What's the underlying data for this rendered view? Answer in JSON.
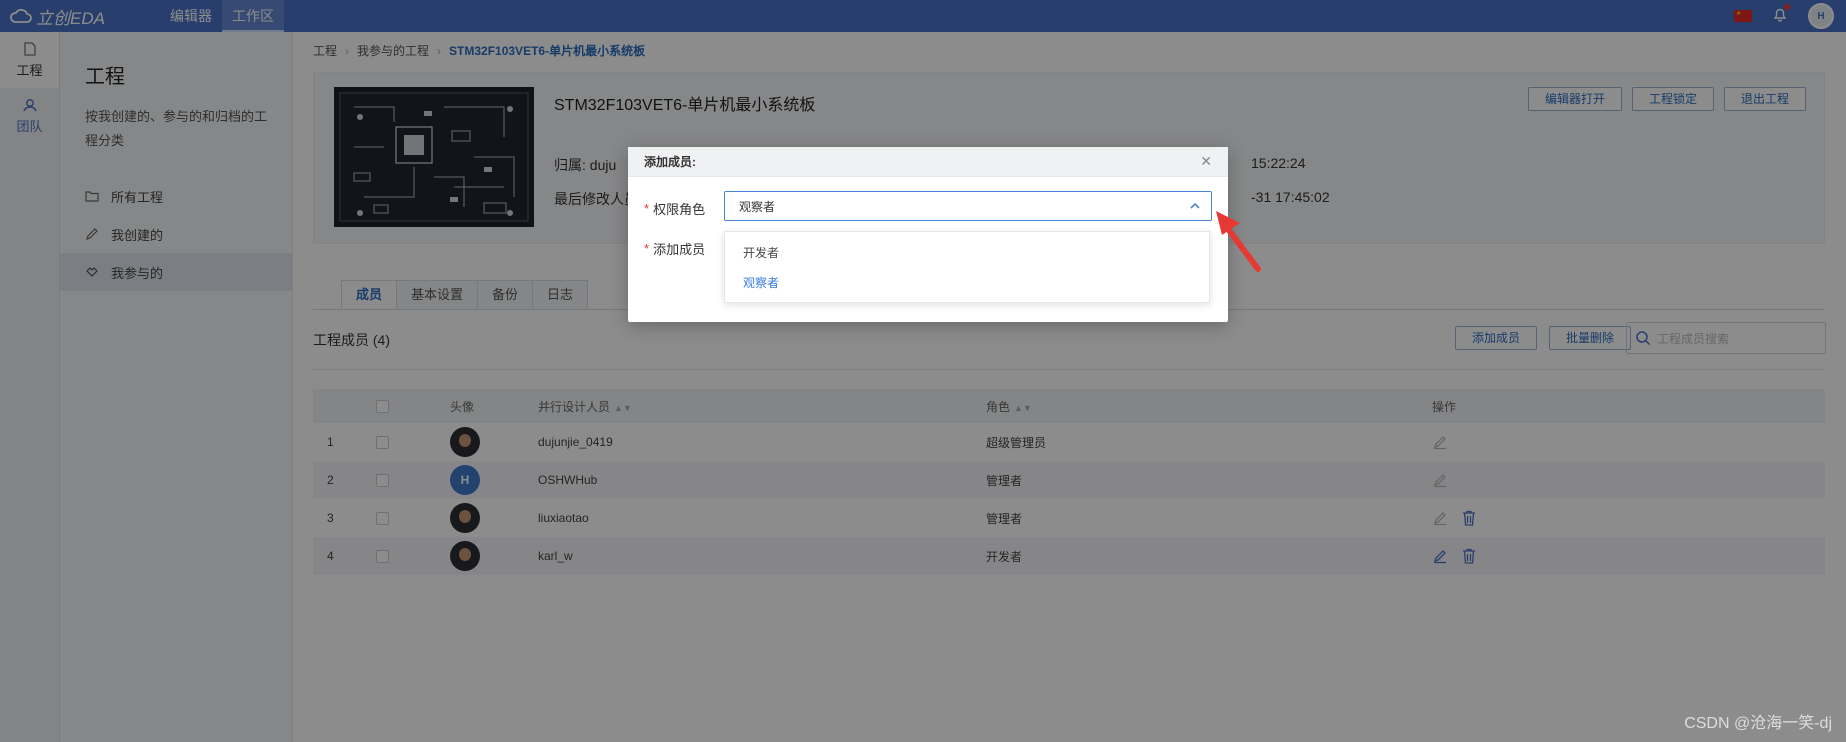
{
  "app": {
    "logo_text": "立创EDA",
    "nav": [
      "编辑器",
      "工作区"
    ]
  },
  "rail": {
    "items": [
      {
        "label": "工程"
      },
      {
        "label": "团队"
      }
    ]
  },
  "sidebar": {
    "title": "工程",
    "desc": "按我创建的、参与的和归档的工程分类",
    "menu": [
      {
        "label": "所有工程"
      },
      {
        "label": "我创建的"
      },
      {
        "label": "我参与的"
      }
    ]
  },
  "breadcrumb": [
    "工程",
    "我参与的工程",
    "STM32F103VET6-单片机最小系统板"
  ],
  "project": {
    "title": "STM32F103VET6-单片机最小系统板",
    "owner_label": "归属:",
    "owner_partial": "duju",
    "last_modifier_label": "最后修改人员",
    "date1_partial": "15:22:24",
    "date2_partial": "-31 17:45:02",
    "buttons": [
      "编辑器打开",
      "工程锁定",
      "退出工程"
    ]
  },
  "tabs": [
    "成员",
    "基本设置",
    "备份",
    "日志"
  ],
  "members": {
    "title": "工程成员 (4)",
    "add_button": "添加成员",
    "batch_delete_button": "批量删除",
    "search_placeholder": "工程成员搜索",
    "columns": {
      "avatar": "头像",
      "designer": "并行设计人员",
      "role": "角色",
      "ops": "操作"
    },
    "rows": [
      {
        "idx": "1",
        "name": "dujunjie_0419",
        "role": "超级管理员"
      },
      {
        "idx": "2",
        "name": "OSHWHub",
        "role": "管理者"
      },
      {
        "idx": "3",
        "name": "liuxiaotao",
        "role": "管理者"
      },
      {
        "idx": "4",
        "name": "karl_w",
        "role": "开发者"
      }
    ]
  },
  "modal": {
    "title": "添加成员:",
    "role_label": "权限角色",
    "member_label": "添加成员",
    "selected_role": "观察者",
    "options": [
      {
        "label": "开发者"
      },
      {
        "label": "观察者"
      }
    ]
  },
  "watermark": "CSDN @沧海一笑-dj",
  "colors": {
    "topbar": "#4a74c9",
    "accent": "#2a6ebd",
    "annotation_arrow": "#e53935"
  }
}
